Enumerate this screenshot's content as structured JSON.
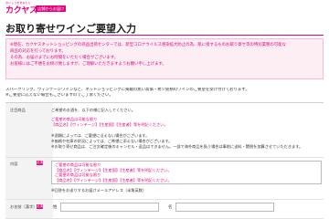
{
  "header": {
    "logo_tagline": "おいしさをあなたに",
    "logo": "カクヤス",
    "shop_button": "店舗からお届け"
  },
  "page": {
    "title": "お取り寄せワインご要望入力"
  },
  "notice": {
    "lines": [
      "※現在、カクヤスネットショッピングの商品出荷センターでは、新型コロナウイルス感染拡大防止の為、肌に接するものお取り寄せ等の特別業務の可能な",
      "商品の対応を行っております。",
      "その為、お届けまでにお時間をいただく場合がございます。",
      "お客様にはご不便をお掛け致しますが、ご理解いただきますようお願い申し上げます。"
    ]
  },
  "intro": {
    "lines": [
      "スパークリング、ウィンテージワインなど、ネットショッピングに掲載の無い高価・希少銘柄のワインのご要望を受け付けております。",
      "※ご要望に応えない場合もございますのでご了承ください。"
    ]
  },
  "form": {
    "products_label": "注目商品",
    "products_lines": [
      "ご希望のお酒を、以下の様に記入してください。",
      "ご要望の商品は可能な限り",
      "【商品名】【ヴィンテージ】【生産国】【生産者】等を明記ください。",
      "※酒類によっては、ご要望に沿えない場合がございます。",
      "※価格や在庫の状況によっては、ご希望に添えない場合がございます。",
      "※お取り寄せ商品は、ご注文確定後のキャンセル・返品はできません。一部で海外商品を扱う場合は事前に送料・関税を加算させていただきます。"
    ],
    "content_label": "内容",
    "required_badge": "必須",
    "content_textarea_lines": [
      "ご要望の商品は可能な限り",
      "【商品名】【ヴィンテージ】【生産国】【生産者】等を明記ください。",
      "ご要望の商品は可能な限り",
      "【商品名】【ヴィンテージ】【生産国】【生産者】等を明記ください。"
    ],
    "content_note": "※回答をお送りするお届けメールアドレス（半角英数）",
    "name_label": "お名前（漢字）",
    "name_sei_label": "姓",
    "name_mei_label": "名",
    "name_sei_value": "",
    "name_mei_value": ""
  },
  "colors": {
    "accent": "#e4007f",
    "notice_bg": "#fdeef4",
    "label_bg": "#f3f3f3"
  }
}
